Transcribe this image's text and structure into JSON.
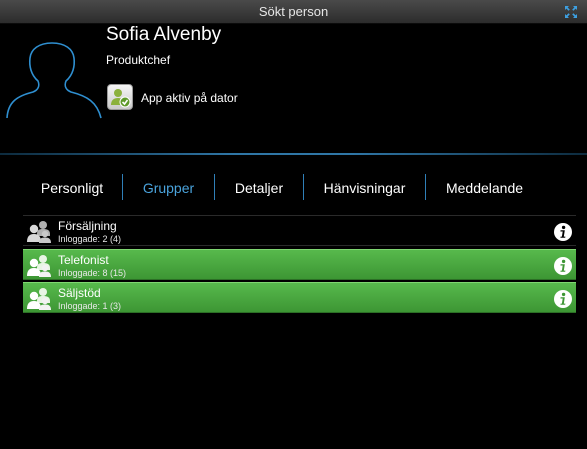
{
  "window": {
    "title": "Sökt person",
    "expand_icon": "expand-icon"
  },
  "person": {
    "name": "Sofia Alvenby",
    "role": "Produktchef",
    "avatar_icon": "person-silhouette-icon",
    "app_status": {
      "icon": "computer-user-check-icon",
      "label": "App aktiv på dator"
    }
  },
  "tabs": [
    {
      "label": "Personligt",
      "active": false
    },
    {
      "label": "Grupper",
      "active": true
    },
    {
      "label": "Detaljer",
      "active": false
    },
    {
      "label": "Hänvisningar",
      "active": false
    },
    {
      "label": "Meddelande",
      "active": false
    }
  ],
  "groups": [
    {
      "name": "Försäljning",
      "logged_in": "Inloggade: 2 (4)",
      "highlighted": false,
      "icon": "group-icon",
      "action_icon": "info-icon"
    },
    {
      "name": "Telefonist",
      "logged_in": "Inloggade: 8 (15)",
      "highlighted": true,
      "icon": "group-icon",
      "action_icon": "info-icon"
    },
    {
      "name": "Säljstöd",
      "logged_in": "Inloggade: 1 (3)",
      "highlighted": true,
      "icon": "group-icon",
      "action_icon": "info-icon"
    }
  ],
  "colors": {
    "background": "#000000",
    "accent_blue": "#4aa3dc",
    "divider_blue": "#2f76a6",
    "group_highlight": "#4aa73f",
    "titlebar": "#3a3a3a"
  }
}
